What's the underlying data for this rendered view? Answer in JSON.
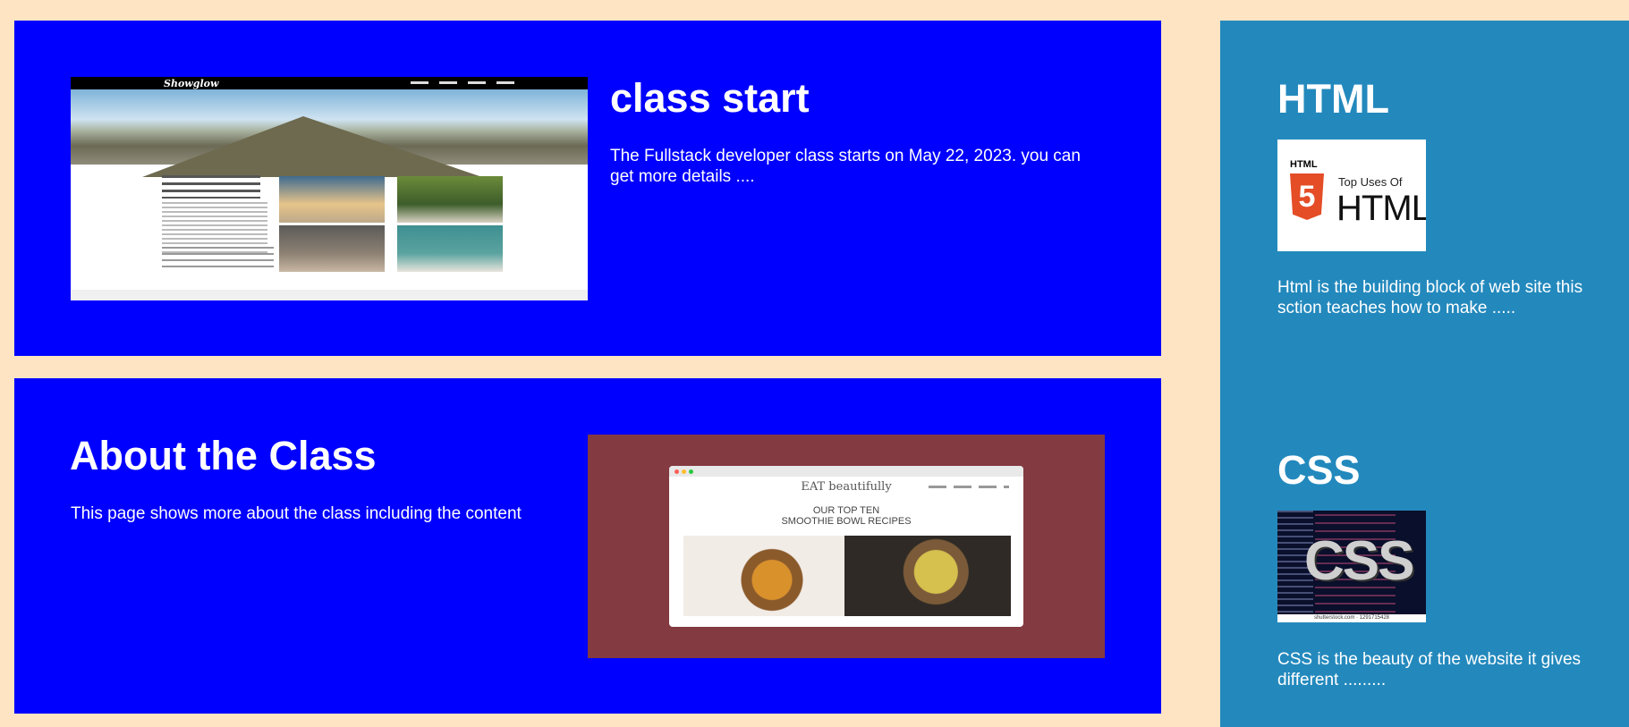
{
  "main": {
    "class_start": {
      "title": "class start",
      "text": "The Fullstack developer class starts on May 22, 2023. you can get more details ....",
      "image_label": "website-screenshot-thumbnail",
      "image_logo_text": "Showglow"
    },
    "about": {
      "title": "About the Class",
      "text": "This page shows more about the class including the content",
      "image_brand": "EAT beautifully",
      "image_subtitle_1": "OUR TOP TEN",
      "image_subtitle_2": "SMOOTHIE BOWL RECIPES"
    }
  },
  "sidebar": {
    "html": {
      "title": "HTML",
      "img_small_label": "HTML",
      "img_shield": "5",
      "img_top_uses": "Top Uses Of",
      "img_big_label": "HTML",
      "text": "Html is the building block of web site this sction teaches how to make ....."
    },
    "css": {
      "title": "CSS",
      "img_big_label": "CSS",
      "img_credit": "shutterstock.com · 1291715428",
      "text": "CSS is the beauty of the website it gives different ........."
    }
  },
  "colors": {
    "page_bg": "#ffe4c4",
    "panel_bg": "#0000ff",
    "sidebar_bg": "#2389bd",
    "text": "#ffffff",
    "image2_bg": "#833a40"
  }
}
